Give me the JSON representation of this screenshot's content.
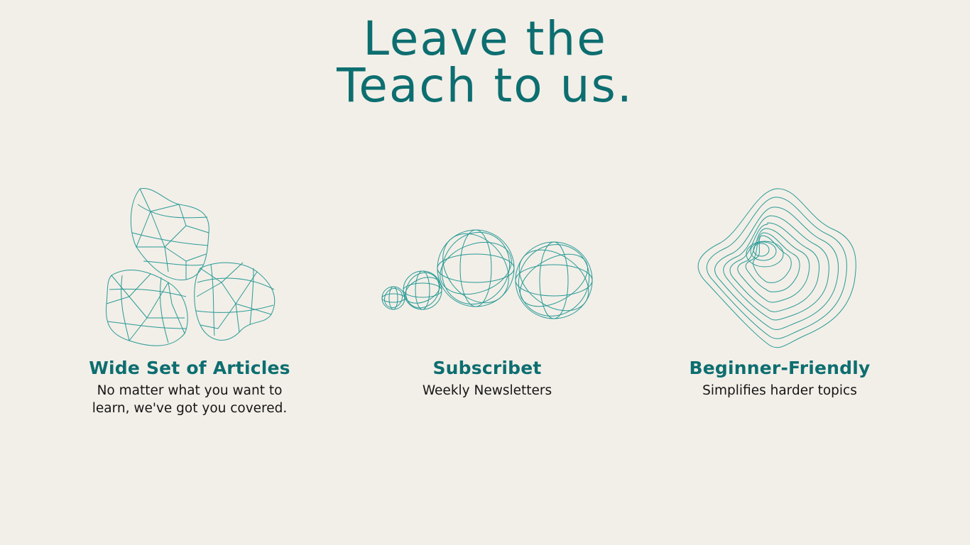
{
  "hero": {
    "title_line1": "Leave the",
    "title_line2": "Teach to us."
  },
  "features": [
    {
      "icon": "polyhedron-cluster-icon",
      "title": "Wide Set of Articles",
      "description": "No matter what you want to learn, we've got you covered."
    },
    {
      "icon": "wireframe-spheres-icon",
      "title": "Subscribet",
      "description": "Weekly Newsletters"
    },
    {
      "icon": "contour-lines-icon",
      "title": "Beginner-Friendly",
      "description": "Simplifies harder topics"
    }
  ],
  "colors": {
    "background": "#f2efe8",
    "accent": "#0d6e70",
    "line_art": "#2a9a96",
    "body_text": "#151515"
  }
}
